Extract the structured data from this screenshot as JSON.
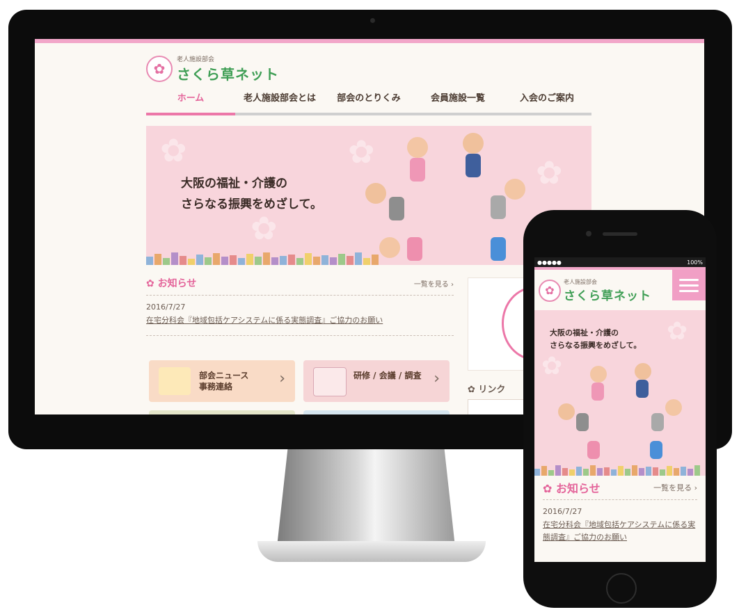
{
  "desktop": {
    "logo": {
      "sub": "老人施設部会",
      "main": "さくら草ネット"
    },
    "nav": [
      {
        "label": "ホーム"
      },
      {
        "label": "老人施設部会とは"
      },
      {
        "label": "部会のとりくみ"
      },
      {
        "label": "会員施設一覧"
      },
      {
        "label": "入会のご案内"
      }
    ],
    "hero": {
      "line1": "大阪の福祉・介護の",
      "line2": "さらなる振興をめざして。"
    },
    "news": {
      "title": "お知らせ",
      "more": "一覧を見る ›",
      "items": [
        {
          "date": "2016/7/27",
          "text": "在宅分科会『地域包括ケアシステムに係る実態調査』ご協力のお願い"
        }
      ]
    },
    "cards": [
      {
        "label": "部会ニュース\n事務連絡",
        "color": "#f9dbc6"
      },
      {
        "label": "研修 / 会議 / 調査",
        "color": "#f6d5d6"
      },
      {
        "label": "",
        "color": "#e4e6c9"
      },
      {
        "label": "",
        "color": "#d6e6ef"
      }
    ],
    "sidebar": {
      "link_title": "リンク"
    }
  },
  "phone": {
    "status": {
      "left": "●●●●● ",
      "right": "100%"
    },
    "logo": {
      "sub": "老人施設部会",
      "main": "さくら草ネット"
    },
    "hero": {
      "line1": "大阪の福祉・介護の",
      "line2": "さらなる振興をめざして。"
    },
    "news": {
      "title": "お知らせ",
      "more": "一覧を見る ›",
      "date": "2016/7/27",
      "text": "在宅分科会『地域包括ケアシステムに係る実態調査』ご協力のお願い"
    }
  },
  "colors": {
    "accent_pink": "#ec77a8",
    "logo_green": "#3f9e55",
    "hero_pink": "#f8d5dc"
  },
  "icons": [
    "flower-icon",
    "menu-icon",
    "chevron-right-icon",
    "news-board-icon",
    "seminar-icon"
  ]
}
